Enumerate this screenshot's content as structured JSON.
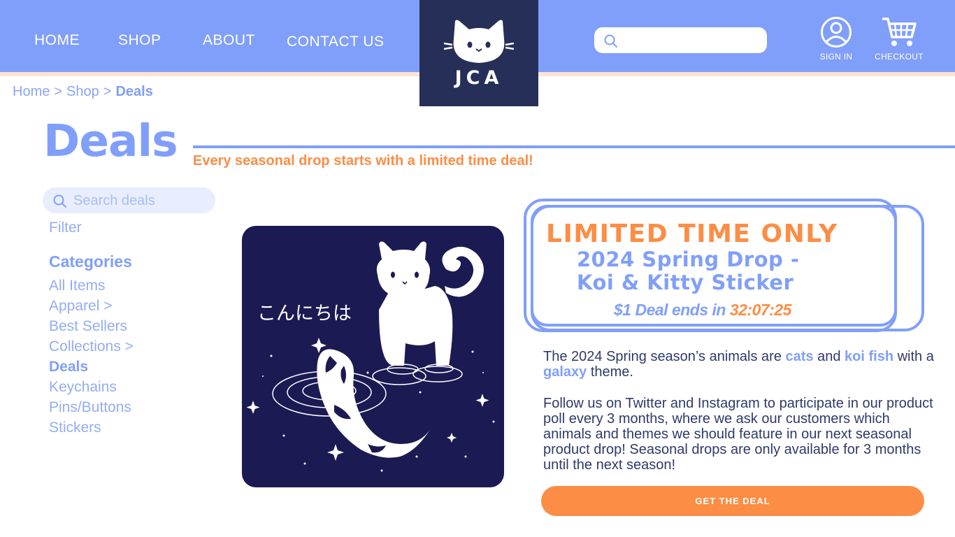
{
  "nav": {
    "home": "HOME",
    "shop": "SHOP",
    "about": "ABOUT",
    "contact": "CONTACT US"
  },
  "logo": {
    "text": "JCA",
    "icon": "cat-face-icon"
  },
  "header": {
    "search_placeholder": "",
    "sign_in": "SIGN IN",
    "checkout": "CHECKOUT"
  },
  "breadcrumb": {
    "items": [
      "Home",
      "Shop",
      "Deals"
    ],
    "separator": ">"
  },
  "page": {
    "title": "Deals",
    "subtitle": "Every seasonal drop starts with a limited time deal!"
  },
  "sidebar": {
    "search_placeholder": "Search deals",
    "filter": "Filter",
    "categories_heading": "Categories",
    "categories": [
      {
        "label": "All Items"
      },
      {
        "label": "Apparel >"
      },
      {
        "label": "Best Sellers"
      },
      {
        "label": "Collections >"
      },
      {
        "label": "Deals",
        "active": true
      },
      {
        "label": "Keychains"
      },
      {
        "label": "Pins/Buttons"
      },
      {
        "label": "Stickers"
      }
    ]
  },
  "product": {
    "art_text": "こんにちは",
    "banner_heading": "LIMITED TIME ONLY",
    "name_line1": "2024 Spring Drop -",
    "name_line2": "Koi & Kitty Sticker",
    "deal_prefix": "$1 Deal ends in ",
    "countdown": "32:07:25",
    "desc_part1": "The 2024 Spring season’s animals are ",
    "desc_cats": "cats",
    "desc_and": " and ",
    "desc_koi": "koi fish",
    "desc_with": " with a ",
    "desc_galaxy": "galaxy",
    "desc_theme": " theme.",
    "desc_follow": "Follow us on Twitter and Instagram to participate in our product poll every 3 months, where we ask our customers which animals and themes we should feature in our next seasonal product drop! Seasonal drops are only available for 3 months until the next season!",
    "cta": "GET THE DEAL"
  },
  "colors": {
    "primary": "#809ffb",
    "accent": "#fc8d45",
    "logo_bg": "#262f58",
    "art_bg": "#1c1a52"
  }
}
